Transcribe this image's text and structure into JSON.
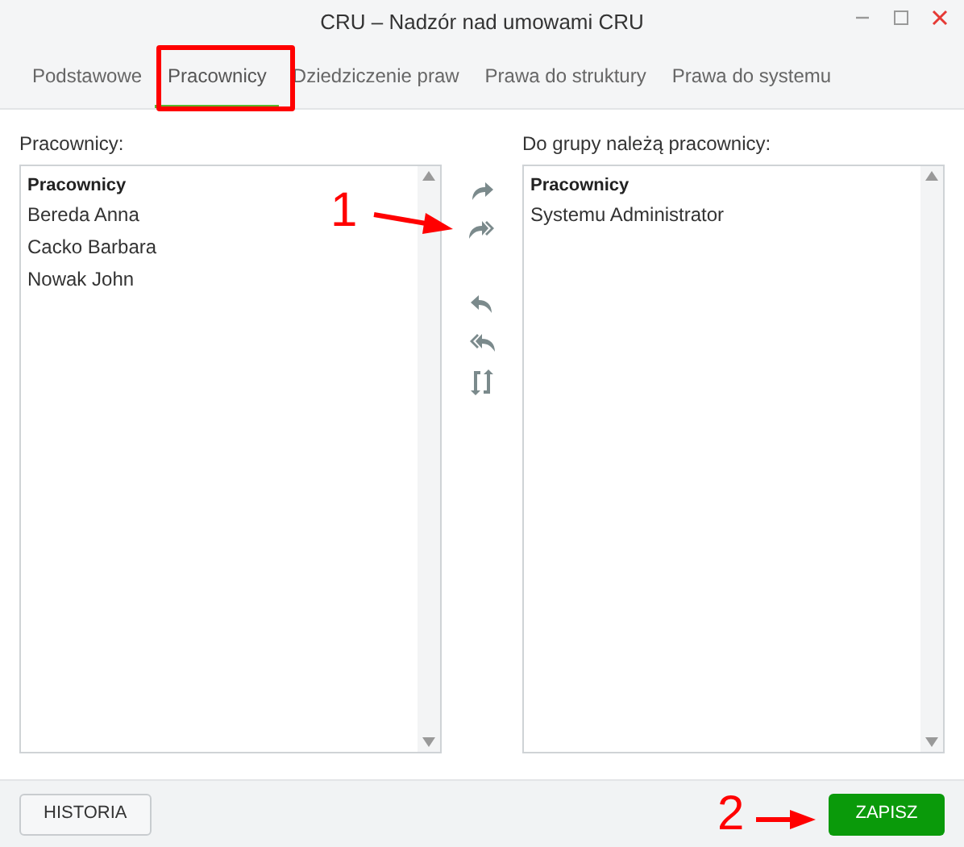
{
  "window": {
    "title": "CRU – Nadzór nad umowami CRU"
  },
  "tabs": [
    {
      "label": "Podstawowe",
      "selected": false
    },
    {
      "label": "Pracownicy",
      "selected": true
    },
    {
      "label": "Dziedziczenie praw",
      "selected": false
    },
    {
      "label": "Prawa do struktury",
      "selected": false
    },
    {
      "label": "Prawa do systemu",
      "selected": false
    }
  ],
  "available": {
    "label": "Pracownicy:",
    "header": "Pracownicy",
    "items": [
      "Bereda Anna",
      "Cacko Barbara",
      "Nowak John"
    ]
  },
  "members": {
    "label": "Do grupy należą pracownicy:",
    "header": "Pracownicy",
    "items": [
      "Systemu Administrator"
    ]
  },
  "transfer_buttons": [
    {
      "kind": "add"
    },
    {
      "kind": "add_all"
    },
    {
      "kind": "remove"
    },
    {
      "kind": "remove_all"
    },
    {
      "kind": "swap"
    }
  ],
  "footer": {
    "history_button": "HISTORIA",
    "save_button": "ZAPISZ"
  },
  "annotations": [
    {
      "kind": "box"
    },
    {
      "kind": "marker",
      "label": "1"
    },
    {
      "kind": "marker",
      "label": "2"
    }
  ]
}
